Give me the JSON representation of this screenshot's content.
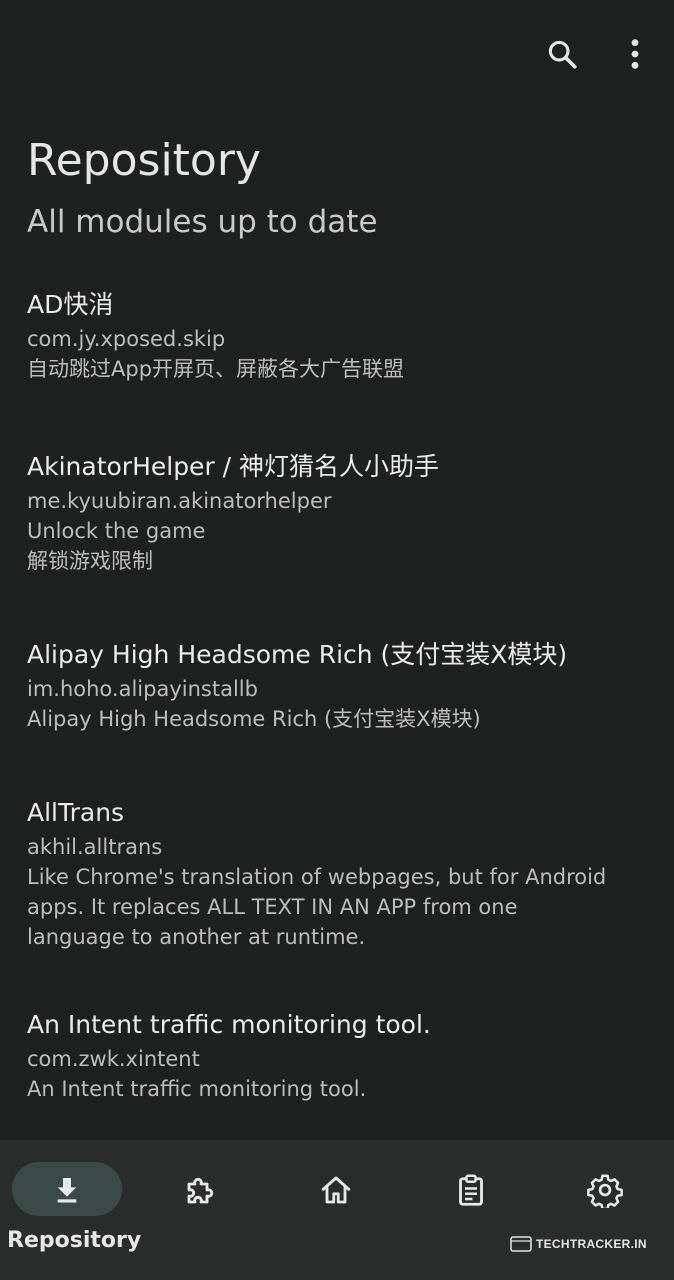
{
  "header": {
    "title": "Repository",
    "subtitle": "All modules up to date"
  },
  "toolbar": {
    "search_icon": "search-icon",
    "more_icon": "more-vert-icon"
  },
  "modules": [
    {
      "name": "AD快消",
      "package": "com.jy.xposed.skip",
      "description": [
        "自动跳过App开屏页、屏蔽各大广告联盟"
      ]
    },
    {
      "name": "AkinatorHelper / 神灯猜名人小助手",
      "package": "me.kyuubiran.akinatorhelper",
      "description": [
        "Unlock the game",
        "解锁游戏限制"
      ]
    },
    {
      "name": "Alipay High Headsome Rich (支付宝装X模块)",
      "package": "im.hoho.alipayinstallb",
      "description": [
        "Alipay High Headsome Rich (支付宝装X模块)"
      ]
    },
    {
      "name": "AllTrans",
      "package": "akhil.alltrans",
      "description": [
        "Like Chrome's translation of webpages, but for Android",
        "apps. It replaces ALL TEXT IN AN APP from one",
        "language to another at runtime."
      ]
    },
    {
      "name": "An Intent traffic monitoring tool.",
      "package": "com.zwk.xintent",
      "description": [
        "An Intent traffic monitoring tool."
      ]
    }
  ],
  "bottom_nav": {
    "items": [
      {
        "icon": "download-icon",
        "label": "Repository",
        "selected": true
      },
      {
        "icon": "puzzle-icon",
        "label": "",
        "selected": false
      },
      {
        "icon": "home-icon",
        "label": "",
        "selected": false
      },
      {
        "icon": "clipboard-icon",
        "label": "",
        "selected": false
      },
      {
        "icon": "gear-icon",
        "label": "",
        "selected": false
      }
    ]
  },
  "watermark": {
    "text": "TECHTRACKER.IN"
  },
  "colors": {
    "background": "#1f2020",
    "nav_background": "#2b2c2c",
    "selected_pill": "#3a4a48"
  }
}
